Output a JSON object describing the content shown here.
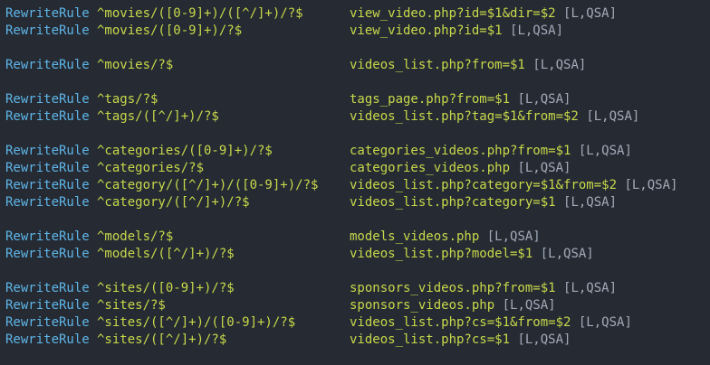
{
  "editor": {
    "colors": {
      "background": "#252a33",
      "keyword": "#5fb6e8",
      "string": "#c8d94a",
      "flags": "#a3abb8"
    },
    "lines": [
      {
        "type": "rule",
        "keyword": "RewriteRule",
        "pattern": "^movies/([0-9]+)/([^/]+)/?$",
        "target": "view_video.php?id=$1&dir=$2",
        "flags": "[L,QSA]"
      },
      {
        "type": "rule",
        "keyword": "RewriteRule",
        "pattern": "^movies/([0-9]+)/?$",
        "target": "view_video.php?id=$1",
        "flags": "[L,QSA]"
      },
      {
        "type": "blank"
      },
      {
        "type": "rule",
        "keyword": "RewriteRule",
        "pattern": "^movies/?$",
        "target": "videos_list.php?from=$1",
        "flags": "[L,QSA]"
      },
      {
        "type": "blank"
      },
      {
        "type": "rule",
        "keyword": "RewriteRule",
        "pattern": "^tags/?$",
        "target": "tags_page.php?from=$1",
        "flags": "[L,QSA]"
      },
      {
        "type": "rule",
        "keyword": "RewriteRule",
        "pattern": "^tags/([^/]+)/?$",
        "target": "videos_list.php?tag=$1&from=$2",
        "flags": "[L,QSA]"
      },
      {
        "type": "blank"
      },
      {
        "type": "rule",
        "keyword": "RewriteRule",
        "pattern": "^categories/([0-9]+)/?$",
        "target": "categories_videos.php?from=$1",
        "flags": "[L,QSA]"
      },
      {
        "type": "rule",
        "keyword": "RewriteRule",
        "pattern": "^categories/?$",
        "target": "categories_videos.php",
        "flags": "[L,QSA]"
      },
      {
        "type": "rule",
        "keyword": "RewriteRule",
        "pattern": "^category/([^/]+)/([0-9]+)/?$",
        "target": "videos_list.php?category=$1&from=$2",
        "flags": "[L,QSA]"
      },
      {
        "type": "rule",
        "keyword": "RewriteRule",
        "pattern": "^category/([^/]+)/?$",
        "target": "videos_list.php?category=$1",
        "flags": "[L,QSA]"
      },
      {
        "type": "blank"
      },
      {
        "type": "rule",
        "keyword": "RewriteRule",
        "pattern": "^models/?$",
        "target": "models_videos.php",
        "flags": "[L,QSA]"
      },
      {
        "type": "rule",
        "keyword": "RewriteRule",
        "pattern": "^models/([^/]+)/?$",
        "target": "videos_list.php?model=$1",
        "flags": "[L,QSA]"
      },
      {
        "type": "blank"
      },
      {
        "type": "rule",
        "keyword": "RewriteRule",
        "pattern": "^sites/([0-9]+)/?$",
        "target": "sponsors_videos.php?from=$1",
        "flags": "[L,QSA]"
      },
      {
        "type": "rule",
        "keyword": "RewriteRule",
        "pattern": "^sites/?$",
        "target": "sponsors_videos.php",
        "flags": "[L,QSA]"
      },
      {
        "type": "rule",
        "keyword": "RewriteRule",
        "pattern": "^sites/([^/]+)/([0-9]+)/?$",
        "target": "videos_list.php?cs=$1&from=$2",
        "flags": "[L,QSA]"
      },
      {
        "type": "rule",
        "keyword": "RewriteRule",
        "pattern": "^sites/([^/]+)/?$",
        "target": "videos_list.php?cs=$1",
        "flags": "[L,QSA]"
      }
    ]
  }
}
